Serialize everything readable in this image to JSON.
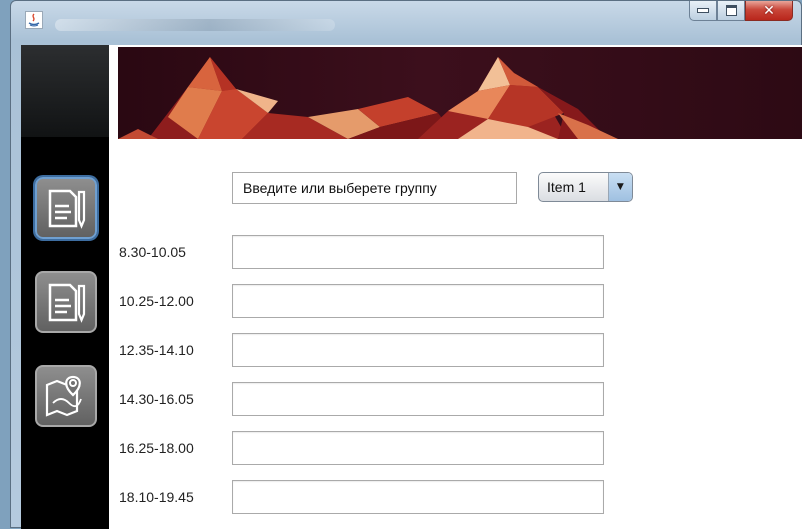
{
  "window": {
    "accent": "#c9473a"
  },
  "sidebar": {
    "items": [
      {
        "icon": "document-edit-icon",
        "active": true
      },
      {
        "icon": "document-edit-icon",
        "active": false
      },
      {
        "icon": "map-pin-icon",
        "active": false
      }
    ]
  },
  "group": {
    "placeholder": "Введите или выберете группу",
    "value": "Введите или выберете группу"
  },
  "combo": {
    "selected": "Item 1"
  },
  "schedule": {
    "rows": [
      {
        "time": "8.30-10.05",
        "value": ""
      },
      {
        "time": "10.25-12.00",
        "value": ""
      },
      {
        "time": "12.35-14.10",
        "value": ""
      },
      {
        "time": "14.30-16.05",
        "value": ""
      },
      {
        "time": "16.25-18.00",
        "value": ""
      },
      {
        "time": "18.10-19.45",
        "value": ""
      }
    ]
  }
}
